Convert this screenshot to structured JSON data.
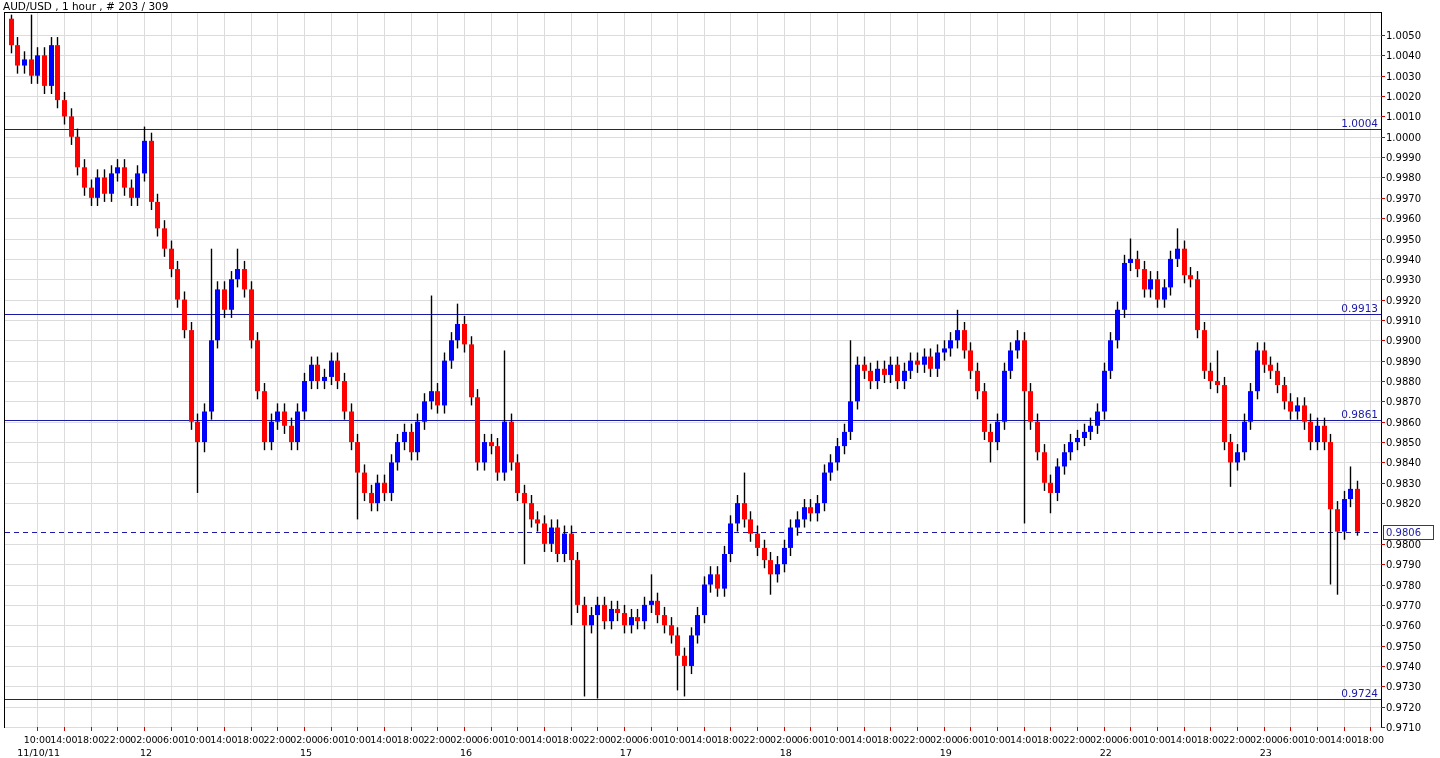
{
  "title": "AUD/USD , 1 hour , # 203 / 309",
  "chart": {
    "chart_data": {
      "type": "candlestick",
      "grid": true,
      "ylim": [
        0.971,
        1.00613
      ],
      "categories": [
        null,
        null,
        null,
        null,
        "10:00",
        null,
        null,
        null,
        "14:00",
        null,
        null,
        null,
        "18:00",
        null,
        null,
        null,
        "22:00",
        null,
        null,
        null,
        "02:00",
        null,
        null,
        null,
        "06:00",
        null,
        null,
        null,
        "10:00",
        null,
        null,
        null,
        "14:00",
        null,
        null,
        null,
        "18:00",
        null,
        null,
        null,
        "22:00",
        null,
        null,
        null,
        "02:00",
        null,
        null,
        null,
        "06:00",
        null,
        null,
        null,
        "10:00",
        null,
        null,
        null,
        "14:00",
        null,
        null,
        null,
        "18:00",
        null,
        null,
        null,
        "22:00",
        null,
        null,
        null,
        "02:00",
        null,
        null,
        null,
        "06:00",
        null,
        null,
        null,
        "10:00",
        null,
        null,
        null,
        "14:00",
        null,
        null,
        null,
        "18:00",
        null,
        null,
        null,
        "22:00",
        null,
        null,
        null,
        "02:00",
        null,
        null,
        null,
        "06:00",
        null,
        null,
        null,
        "10:00",
        null,
        null,
        null,
        "14:00",
        null,
        null,
        null,
        "18:00",
        null,
        null,
        null,
        "22:00",
        null,
        null,
        null,
        "02:00",
        null,
        null,
        null,
        "06:00",
        null,
        null,
        null,
        "10:00",
        null,
        null,
        null,
        "14:00",
        null,
        null,
        null,
        "18:00",
        null,
        null,
        null,
        "22:00",
        null,
        null,
        null,
        "02:00",
        null,
        null,
        null,
        "06:00",
        null,
        null,
        null,
        "10:00",
        null,
        null,
        null,
        "14:00",
        null,
        null,
        null,
        "18:00",
        null,
        null,
        null,
        "22:00",
        null,
        null,
        null,
        "02:00",
        null,
        null,
        null,
        "06:00",
        null,
        null,
        null,
        "10:00",
        null,
        null,
        null,
        "14:00",
        null,
        null,
        null,
        "18:00",
        null,
        null,
        null,
        "22:00",
        null,
        null,
        null,
        "02:00",
        null,
        null,
        null,
        "06:00",
        null,
        null,
        null,
        "10:00",
        null,
        null,
        null,
        "14:00",
        null,
        null,
        null,
        "18:00"
      ],
      "ohlc": [
        [
          1.0058,
          1.006,
          1.0041,
          1.0045
        ],
        [
          1.0045,
          1.0049,
          1.0031,
          1.0035
        ],
        [
          1.0035,
          1.0042,
          1.0031,
          1.0038
        ],
        [
          1.0038,
          1.006,
          1.0026,
          1.003
        ],
        [
          1.003,
          1.0044,
          1.0026,
          1.004
        ],
        [
          1.004,
          1.0044,
          1.0021,
          1.0025
        ],
        [
          1.0025,
          1.0049,
          1.0021,
          1.0045
        ],
        [
          1.0045,
          1.0049,
          1.0014,
          1.0018
        ],
        [
          1.0018,
          1.0022,
          1.0006,
          1.001
        ],
        [
          1.001,
          1.0014,
          0.9996,
          1.0
        ],
        [
          1.0,
          1.0004,
          0.9981,
          0.9985
        ],
        [
          0.9985,
          0.9989,
          0.9971,
          0.9975
        ],
        [
          0.9975,
          0.9979,
          0.9966,
          0.997
        ],
        [
          0.997,
          0.9984,
          0.9966,
          0.998
        ],
        [
          0.998,
          0.9984,
          0.9968,
          0.9972
        ],
        [
          0.9972,
          0.9986,
          0.9968,
          0.9982
        ],
        [
          0.9982,
          0.9989,
          0.9978,
          0.9985
        ],
        [
          0.9985,
          0.9989,
          0.9971,
          0.9975
        ],
        [
          0.9975,
          0.9979,
          0.9966,
          0.997
        ],
        [
          0.997,
          0.9986,
          0.9966,
          0.9982
        ],
        [
          0.9982,
          1.0005,
          0.9978,
          0.9998
        ],
        [
          0.9998,
          1.0002,
          0.9964,
          0.9968
        ],
        [
          0.9968,
          0.9972,
          0.9951,
          0.9955
        ],
        [
          0.9955,
          0.9959,
          0.9941,
          0.9945
        ],
        [
          0.9945,
          0.9949,
          0.9931,
          0.9935
        ],
        [
          0.9935,
          0.9939,
          0.9916,
          0.992
        ],
        [
          0.992,
          0.9924,
          0.9901,
          0.9905
        ],
        [
          0.9905,
          0.9909,
          0.9856,
          0.986
        ],
        [
          0.986,
          0.9864,
          0.9825,
          0.985
        ],
        [
          0.985,
          0.9869,
          0.9845,
          0.9865
        ],
        [
          0.9865,
          0.9945,
          0.9861,
          0.99
        ],
        [
          0.99,
          0.9929,
          0.9896,
          0.9925
        ],
        [
          0.9925,
          0.9929,
          0.9911,
          0.9915
        ],
        [
          0.9915,
          0.9934,
          0.9911,
          0.993
        ],
        [
          0.993,
          0.9945,
          0.9926,
          0.9935
        ],
        [
          0.9935,
          0.9939,
          0.9921,
          0.9925
        ],
        [
          0.9925,
          0.9929,
          0.9896,
          0.99
        ],
        [
          0.99,
          0.9904,
          0.9871,
          0.9875
        ],
        [
          0.9875,
          0.9879,
          0.9846,
          0.985
        ],
        [
          0.985,
          0.9864,
          0.9846,
          0.986
        ],
        [
          0.986,
          0.9869,
          0.9856,
          0.9865
        ],
        [
          0.9865,
          0.9869,
          0.9854,
          0.9858
        ],
        [
          0.9858,
          0.9862,
          0.9846,
          0.985
        ],
        [
          0.985,
          0.9869,
          0.9846,
          0.9865
        ],
        [
          0.9865,
          0.9884,
          0.9861,
          0.988
        ],
        [
          0.988,
          0.9892,
          0.9876,
          0.9888
        ],
        [
          0.9888,
          0.9892,
          0.9876,
          0.988
        ],
        [
          0.988,
          0.9886,
          0.9876,
          0.9882
        ],
        [
          0.9882,
          0.9894,
          0.9878,
          0.989
        ],
        [
          0.989,
          0.9894,
          0.9876,
          0.988
        ],
        [
          0.988,
          0.9884,
          0.9861,
          0.9865
        ],
        [
          0.9865,
          0.9869,
          0.9846,
          0.985
        ],
        [
          0.985,
          0.9854,
          0.9812,
          0.9835
        ],
        [
          0.9835,
          0.9839,
          0.9821,
          0.9825
        ],
        [
          0.9825,
          0.9829,
          0.9816,
          0.982
        ],
        [
          0.982,
          0.9834,
          0.9816,
          0.983
        ],
        [
          0.983,
          0.9834,
          0.9821,
          0.9825
        ],
        [
          0.9825,
          0.9844,
          0.9821,
          0.984
        ],
        [
          0.984,
          0.9854,
          0.9836,
          0.985
        ],
        [
          0.985,
          0.9859,
          0.9846,
          0.9855
        ],
        [
          0.9855,
          0.9859,
          0.9841,
          0.9845
        ],
        [
          0.9845,
          0.9864,
          0.9841,
          0.986
        ],
        [
          0.986,
          0.9874,
          0.9856,
          0.987
        ],
        [
          0.987,
          0.9922,
          0.9866,
          0.9875
        ],
        [
          0.9875,
          0.9879,
          0.9864,
          0.9868
        ],
        [
          0.9868,
          0.9894,
          0.9864,
          0.989
        ],
        [
          0.989,
          0.9904,
          0.9886,
          0.99
        ],
        [
          0.99,
          0.9918,
          0.9896,
          0.9908
        ],
        [
          0.9908,
          0.9912,
          0.9894,
          0.9898
        ],
        [
          0.9898,
          0.9902,
          0.9868,
          0.9872
        ],
        [
          0.9872,
          0.9876,
          0.9836,
          0.984
        ],
        [
          0.984,
          0.9854,
          0.9836,
          0.985
        ],
        [
          0.985,
          0.9854,
          0.9844,
          0.9848
        ],
        [
          0.9848,
          0.9852,
          0.9831,
          0.9835
        ],
        [
          0.9835,
          0.9895,
          0.9831,
          0.986
        ],
        [
          0.986,
          0.9864,
          0.9836,
          0.984
        ],
        [
          0.984,
          0.9844,
          0.9821,
          0.9825
        ],
        [
          0.9825,
          0.9829,
          0.979,
          0.982
        ],
        [
          0.982,
          0.9824,
          0.9808,
          0.9812
        ],
        [
          0.9812,
          0.9816,
          0.9806,
          0.981
        ],
        [
          0.981,
          0.9814,
          0.9796,
          0.98
        ],
        [
          0.98,
          0.9812,
          0.9796,
          0.9808
        ],
        [
          0.9808,
          0.9812,
          0.9791,
          0.9795
        ],
        [
          0.9795,
          0.9809,
          0.9791,
          0.9805
        ],
        [
          0.9805,
          0.9809,
          0.976,
          0.9792
        ],
        [
          0.9792,
          0.9796,
          0.9766,
          0.977
        ],
        [
          0.977,
          0.9774,
          0.9725,
          0.976
        ],
        [
          0.976,
          0.9769,
          0.9756,
          0.9765
        ],
        [
          0.9765,
          0.9774,
          0.9724,
          0.977
        ],
        [
          0.977,
          0.9774,
          0.9758,
          0.9762
        ],
        [
          0.9762,
          0.9772,
          0.9758,
          0.9768
        ],
        [
          0.9768,
          0.9772,
          0.9762,
          0.9766
        ],
        [
          0.9766,
          0.977,
          0.9756,
          0.976
        ],
        [
          0.976,
          0.9768,
          0.9756,
          0.9764
        ],
        [
          0.9764,
          0.9768,
          0.9758,
          0.9762
        ],
        [
          0.9762,
          0.9774,
          0.9758,
          0.977
        ],
        [
          0.977,
          0.9785,
          0.9766,
          0.9772
        ],
        [
          0.9772,
          0.9776,
          0.9761,
          0.9765
        ],
        [
          0.9765,
          0.9769,
          0.9756,
          0.976
        ],
        [
          0.976,
          0.9764,
          0.9751,
          0.9755
        ],
        [
          0.9755,
          0.9759,
          0.9728,
          0.9745
        ],
        [
          0.9745,
          0.9749,
          0.9725,
          0.974
        ],
        [
          0.974,
          0.9759,
          0.9736,
          0.9755
        ],
        [
          0.9755,
          0.9769,
          0.9751,
          0.9765
        ],
        [
          0.9765,
          0.9784,
          0.9761,
          0.978
        ],
        [
          0.978,
          0.9789,
          0.9776,
          0.9785
        ],
        [
          0.9785,
          0.9789,
          0.9774,
          0.9778
        ],
        [
          0.9778,
          0.9799,
          0.9774,
          0.9795
        ],
        [
          0.9795,
          0.9814,
          0.9791,
          0.981
        ],
        [
          0.981,
          0.9824,
          0.9806,
          0.982
        ],
        [
          0.982,
          0.9835,
          0.9808,
          0.9812
        ],
        [
          0.9812,
          0.9816,
          0.9801,
          0.9805
        ],
        [
          0.9805,
          0.9809,
          0.9794,
          0.9798
        ],
        [
          0.9798,
          0.9802,
          0.9788,
          0.9792
        ],
        [
          0.9792,
          0.9796,
          0.9775,
          0.9785
        ],
        [
          0.9785,
          0.9794,
          0.9781,
          0.979
        ],
        [
          0.979,
          0.9802,
          0.9786,
          0.9798
        ],
        [
          0.9798,
          0.9812,
          0.9794,
          0.9808
        ],
        [
          0.9808,
          0.9816,
          0.9804,
          0.9812
        ],
        [
          0.9812,
          0.9822,
          0.9808,
          0.9818
        ],
        [
          0.9818,
          0.9822,
          0.9811,
          0.9815
        ],
        [
          0.9815,
          0.9824,
          0.9811,
          0.982
        ],
        [
          0.982,
          0.9839,
          0.9816,
          0.9835
        ],
        [
          0.9835,
          0.9844,
          0.9831,
          0.984
        ],
        [
          0.984,
          0.9852,
          0.9836,
          0.9848
        ],
        [
          0.9848,
          0.9859,
          0.9844,
          0.9855
        ],
        [
          0.9855,
          0.99,
          0.9851,
          0.987
        ],
        [
          0.987,
          0.9892,
          0.9866,
          0.9888
        ],
        [
          0.9888,
          0.9892,
          0.9881,
          0.9885
        ],
        [
          0.9885,
          0.9889,
          0.9876,
          0.988
        ],
        [
          0.988,
          0.989,
          0.9876,
          0.9886
        ],
        [
          0.9886,
          0.989,
          0.9879,
          0.9883
        ],
        [
          0.9883,
          0.9892,
          0.9879,
          0.9888
        ],
        [
          0.9888,
          0.9892,
          0.9876,
          0.988
        ],
        [
          0.988,
          0.9889,
          0.9876,
          0.9885
        ],
        [
          0.9885,
          0.9894,
          0.9881,
          0.989
        ],
        [
          0.989,
          0.9894,
          0.9884,
          0.9888
        ],
        [
          0.9888,
          0.9896,
          0.9884,
          0.9892
        ],
        [
          0.9892,
          0.9896,
          0.9882,
          0.9886
        ],
        [
          0.9886,
          0.9898,
          0.9882,
          0.9894
        ],
        [
          0.9894,
          0.99,
          0.989,
          0.9896
        ],
        [
          0.9896,
          0.9904,
          0.9892,
          0.99
        ],
        [
          0.99,
          0.9915,
          0.9896,
          0.9905
        ],
        [
          0.9905,
          0.9909,
          0.9891,
          0.9895
        ],
        [
          0.9895,
          0.9899,
          0.9881,
          0.9885
        ],
        [
          0.9885,
          0.9889,
          0.9871,
          0.9875
        ],
        [
          0.9875,
          0.9879,
          0.9851,
          0.9855
        ],
        [
          0.9855,
          0.9859,
          0.984,
          0.985
        ],
        [
          0.985,
          0.9864,
          0.9846,
          0.986
        ],
        [
          0.986,
          0.9889,
          0.9856,
          0.9885
        ],
        [
          0.9885,
          0.9899,
          0.9881,
          0.9895
        ],
        [
          0.9895,
          0.9905,
          0.9891,
          0.99
        ],
        [
          0.99,
          0.9904,
          0.981,
          0.9875
        ],
        [
          0.9875,
          0.9879,
          0.9856,
          0.986
        ],
        [
          0.986,
          0.9864,
          0.9841,
          0.9845
        ],
        [
          0.9845,
          0.9849,
          0.9826,
          0.983
        ],
        [
          0.983,
          0.9834,
          0.9815,
          0.9825
        ],
        [
          0.9825,
          0.9842,
          0.9821,
          0.9838
        ],
        [
          0.9838,
          0.9849,
          0.9834,
          0.9845
        ],
        [
          0.9845,
          0.9854,
          0.9841,
          0.985
        ],
        [
          0.985,
          0.9856,
          0.9846,
          0.9852
        ],
        [
          0.9852,
          0.9859,
          0.9848,
          0.9855
        ],
        [
          0.9855,
          0.9862,
          0.9851,
          0.9858
        ],
        [
          0.9858,
          0.9869,
          0.9854,
          0.9865
        ],
        [
          0.9865,
          0.9889,
          0.9861,
          0.9885
        ],
        [
          0.9885,
          0.9904,
          0.9881,
          0.99
        ],
        [
          0.99,
          0.9919,
          0.9896,
          0.9915
        ],
        [
          0.9915,
          0.9942,
          0.9911,
          0.9938
        ],
        [
          0.9938,
          0.995,
          0.9934,
          0.994
        ],
        [
          0.994,
          0.9944,
          0.9931,
          0.9935
        ],
        [
          0.9935,
          0.9939,
          0.9921,
          0.9925
        ],
        [
          0.9925,
          0.9934,
          0.9921,
          0.993
        ],
        [
          0.993,
          0.9934,
          0.9916,
          0.992
        ],
        [
          0.992,
          0.993,
          0.9916,
          0.9926
        ],
        [
          0.9926,
          0.9944,
          0.9922,
          0.994
        ],
        [
          0.994,
          0.9955,
          0.9936,
          0.9945
        ],
        [
          0.9945,
          0.9949,
          0.9928,
          0.9932
        ],
        [
          0.9932,
          0.9936,
          0.9926,
          0.993
        ],
        [
          0.993,
          0.9934,
          0.9901,
          0.9905
        ],
        [
          0.9905,
          0.9909,
          0.9881,
          0.9885
        ],
        [
          0.9885,
          0.9889,
          0.9876,
          0.988
        ],
        [
          0.988,
          0.9895,
          0.9874,
          0.9878
        ],
        [
          0.9878,
          0.9882,
          0.9846,
          0.985
        ],
        [
          0.985,
          0.9854,
          0.9828,
          0.984
        ],
        [
          0.984,
          0.9849,
          0.9836,
          0.9845
        ],
        [
          0.9845,
          0.9864,
          0.9841,
          0.986
        ],
        [
          0.986,
          0.9879,
          0.9856,
          0.9875
        ],
        [
          0.9875,
          0.9899,
          0.9871,
          0.9895
        ],
        [
          0.9895,
          0.9899,
          0.9884,
          0.9888
        ],
        [
          0.9888,
          0.9892,
          0.9881,
          0.9885
        ],
        [
          0.9885,
          0.9889,
          0.9874,
          0.9878
        ],
        [
          0.9878,
          0.9882,
          0.9866,
          0.987
        ],
        [
          0.987,
          0.9874,
          0.9861,
          0.9865
        ],
        [
          0.9865,
          0.9872,
          0.9861,
          0.9868
        ],
        [
          0.9868,
          0.9872,
          0.9856,
          0.986
        ],
        [
          0.986,
          0.9864,
          0.9846,
          0.985
        ],
        [
          0.985,
          0.9862,
          0.9846,
          0.9858
        ],
        [
          0.9858,
          0.9862,
          0.9846,
          0.985
        ],
        [
          0.985,
          0.9854,
          0.978,
          0.9817
        ],
        [
          0.9817,
          0.9821,
          0.9775,
          0.9806
        ],
        [
          0.9806,
          0.9826,
          0.9802,
          0.9822
        ],
        [
          0.9822,
          0.9838,
          0.9818,
          0.9827
        ],
        [
          0.9827,
          0.9831,
          0.9804,
          0.9806
        ],
        null,
        null
      ],
      "yticks": [
        {
          "value": 1.005,
          "label": "1.0050"
        },
        {
          "value": 1.004,
          "label": "1.0040"
        },
        {
          "value": 1.003,
          "label": "1.0030"
        },
        {
          "value": 1.002,
          "label": "1.0020"
        },
        {
          "value": 1.001,
          "label": "1.0010"
        },
        {
          "value": 1.0,
          "label": "1.0000"
        },
        {
          "value": 0.999,
          "label": "0.9990"
        },
        {
          "value": 0.998,
          "label": "0.9980"
        },
        {
          "value": 0.997,
          "label": "0.9970"
        },
        {
          "value": 0.996,
          "label": "0.9960"
        },
        {
          "value": 0.995,
          "label": "0.9950"
        },
        {
          "value": 0.994,
          "label": "0.9940"
        },
        {
          "value": 0.993,
          "label": "0.9930"
        },
        {
          "value": 0.992,
          "label": "0.9920"
        },
        {
          "value": 0.991,
          "label": "0.9910"
        },
        {
          "value": 0.99,
          "label": "0.9900"
        },
        {
          "value": 0.989,
          "label": "0.9890"
        },
        {
          "value": 0.988,
          "label": "0.9880"
        },
        {
          "value": 0.987,
          "label": "0.9870"
        },
        {
          "value": 0.986,
          "label": "0.9860"
        },
        {
          "value": 0.985,
          "label": "0.9850"
        },
        {
          "value": 0.984,
          "label": "0.9840"
        },
        {
          "value": 0.983,
          "label": "0.9830"
        },
        {
          "value": 0.982,
          "label": "0.9820"
        },
        {
          "value": 0.98,
          "label": "0.9800"
        },
        {
          "value": 0.979,
          "label": "0.9790"
        },
        {
          "value": 0.978,
          "label": "0.9780"
        },
        {
          "value": 0.977,
          "label": "0.9770"
        },
        {
          "value": 0.976,
          "label": "0.9760"
        },
        {
          "value": 0.975,
          "label": "0.9750"
        },
        {
          "value": 0.974,
          "label": "0.9740"
        },
        {
          "value": 0.973,
          "label": "0.9730"
        },
        {
          "value": 0.972,
          "label": "0.9720"
        },
        {
          "value": 0.971,
          "label": "0.9710"
        }
      ],
      "ref_lines": [
        {
          "axis": "y",
          "value": 1.0004,
          "label": "1.0004"
        },
        {
          "axis": "y",
          "value": 0.9913,
          "label": "0.9913"
        },
        {
          "axis": "y",
          "value": 0.9861,
          "label": "0.9861"
        },
        {
          "axis": "y",
          "value": 0.9724,
          "label": "0.9724"
        },
        {
          "axis": "y",
          "value": 0.9806,
          "label": "0.9806"
        }
      ]
    },
    "date_labels": [
      "11/10/11",
      "12",
      "15",
      "16",
      "17",
      "18",
      "19",
      "22",
      "23"
    ]
  }
}
